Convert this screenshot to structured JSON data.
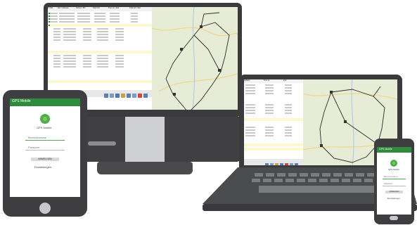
{
  "app_name": "GPS Mobile",
  "login": {
    "username_placeholder": "Benutzername",
    "password_placeholder": "Passwort",
    "login_button": "ANMELDEN",
    "footer_link": "Einstellungen"
  },
  "desktop_table": {
    "headers": [
      "TOUR",
      "Ziel / Adresse",
      "Fahrer / Kfz",
      "Start Ort",
      "Tour-nr. / Zeit",
      "Fahrzeit / Zeit"
    ]
  },
  "laptop_table": {
    "headers": [
      "Abfahrt",
      "Tour-nr.",
      "Zeit"
    ]
  },
  "colors": {
    "monitor_frame": "#3b3b3d",
    "app_green": "#2e8b3d",
    "map_background": "#e9eedb",
    "route_line": "#2b2b2b"
  }
}
